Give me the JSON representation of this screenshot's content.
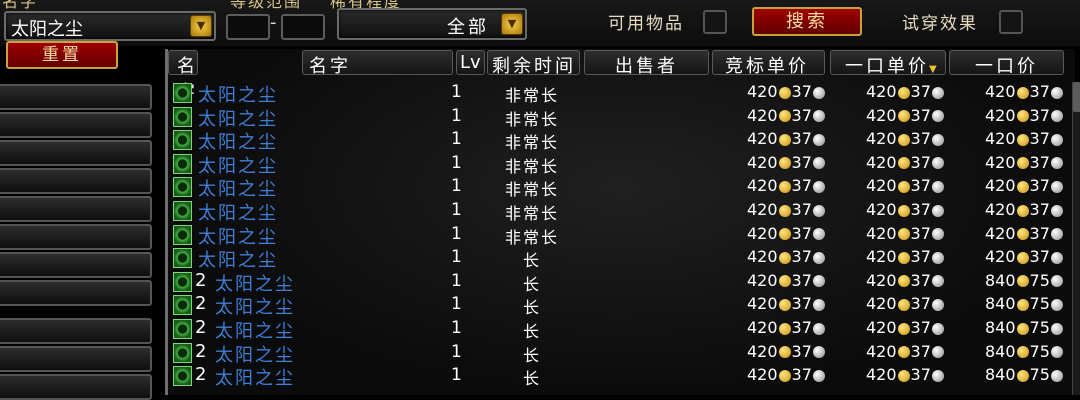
{
  "filters": {
    "name_label": "名字",
    "level_range_label": "等级范围",
    "rarity_label": "稀有程度",
    "name_value": "太阳之尘",
    "rarity_value": "全部",
    "level_dash": "-",
    "usable_label": "可用物品",
    "tryon_label": "试穿效果",
    "search_button": "搜索",
    "reset_button": "重置"
  },
  "columns": {
    "name_small": "名字",
    "name": "名字",
    "level": "Lv",
    "time_left": "剩余时间",
    "seller": "出售者",
    "bid_unit": "竞标单价",
    "buyout_unit": "一口单价",
    "buyout": "一口价"
  },
  "colors": {
    "item_name": "#3e7fd8",
    "header_text": "#ffffff",
    "button_red": "#8a0000",
    "gold_coin": "#f0c030"
  },
  "icons": {
    "dropdown": "gold-arrow-down-icon",
    "sort": "sort-arrow-icon",
    "item": "sun-dust-icon",
    "gold": "gold-coin-icon",
    "silver": "silver-coin-icon"
  },
  "rows": [
    {
      "stack": "",
      "name": "太阳之尘",
      "level": "1",
      "time": "非常长",
      "bid_g": "420",
      "bid_s": "37",
      "unit_g": "420",
      "unit_s": "37",
      "buy_g": "420",
      "buy_s": "37"
    },
    {
      "stack": "",
      "name": "太阳之尘",
      "level": "1",
      "time": "非常长",
      "bid_g": "420",
      "bid_s": "37",
      "unit_g": "420",
      "unit_s": "37",
      "buy_g": "420",
      "buy_s": "37"
    },
    {
      "stack": "",
      "name": "太阳之尘",
      "level": "1",
      "time": "非常长",
      "bid_g": "420",
      "bid_s": "37",
      "unit_g": "420",
      "unit_s": "37",
      "buy_g": "420",
      "buy_s": "37"
    },
    {
      "stack": "",
      "name": "太阳之尘",
      "level": "1",
      "time": "非常长",
      "bid_g": "420",
      "bid_s": "37",
      "unit_g": "420",
      "unit_s": "37",
      "buy_g": "420",
      "buy_s": "37"
    },
    {
      "stack": "",
      "name": "太阳之尘",
      "level": "1",
      "time": "非常长",
      "bid_g": "420",
      "bid_s": "37",
      "unit_g": "420",
      "unit_s": "37",
      "buy_g": "420",
      "buy_s": "37"
    },
    {
      "stack": "",
      "name": "太阳之尘",
      "level": "1",
      "time": "非常长",
      "bid_g": "420",
      "bid_s": "37",
      "unit_g": "420",
      "unit_s": "37",
      "buy_g": "420",
      "buy_s": "37"
    },
    {
      "stack": "",
      "name": "太阳之尘",
      "level": "1",
      "time": "非常长",
      "bid_g": "420",
      "bid_s": "37",
      "unit_g": "420",
      "unit_s": "37",
      "buy_g": "420",
      "buy_s": "37"
    },
    {
      "stack": "",
      "name": "太阳之尘",
      "level": "1",
      "time": "长",
      "bid_g": "420",
      "bid_s": "37",
      "unit_g": "420",
      "unit_s": "37",
      "buy_g": "420",
      "buy_s": "37"
    },
    {
      "stack": "2",
      "name": "太阳之尘",
      "level": "1",
      "time": "长",
      "bid_g": "420",
      "bid_s": "37",
      "unit_g": "420",
      "unit_s": "37",
      "buy_g": "840",
      "buy_s": "75"
    },
    {
      "stack": "2",
      "name": "太阳之尘",
      "level": "1",
      "time": "长",
      "bid_g": "420",
      "bid_s": "37",
      "unit_g": "420",
      "unit_s": "37",
      "buy_g": "840",
      "buy_s": "75"
    },
    {
      "stack": "2",
      "name": "太阳之尘",
      "level": "1",
      "time": "长",
      "bid_g": "420",
      "bid_s": "37",
      "unit_g": "420",
      "unit_s": "37",
      "buy_g": "840",
      "buy_s": "75"
    },
    {
      "stack": "2",
      "name": "太阳之尘",
      "level": "1",
      "time": "长",
      "bid_g": "420",
      "bid_s": "37",
      "unit_g": "420",
      "unit_s": "37",
      "buy_g": "840",
      "buy_s": "75"
    },
    {
      "stack": "2",
      "name": "太阳之尘",
      "level": "1",
      "time": "长",
      "bid_g": "420",
      "bid_s": "37",
      "unit_g": "420",
      "unit_s": "37",
      "buy_g": "840",
      "buy_s": "75"
    }
  ]
}
